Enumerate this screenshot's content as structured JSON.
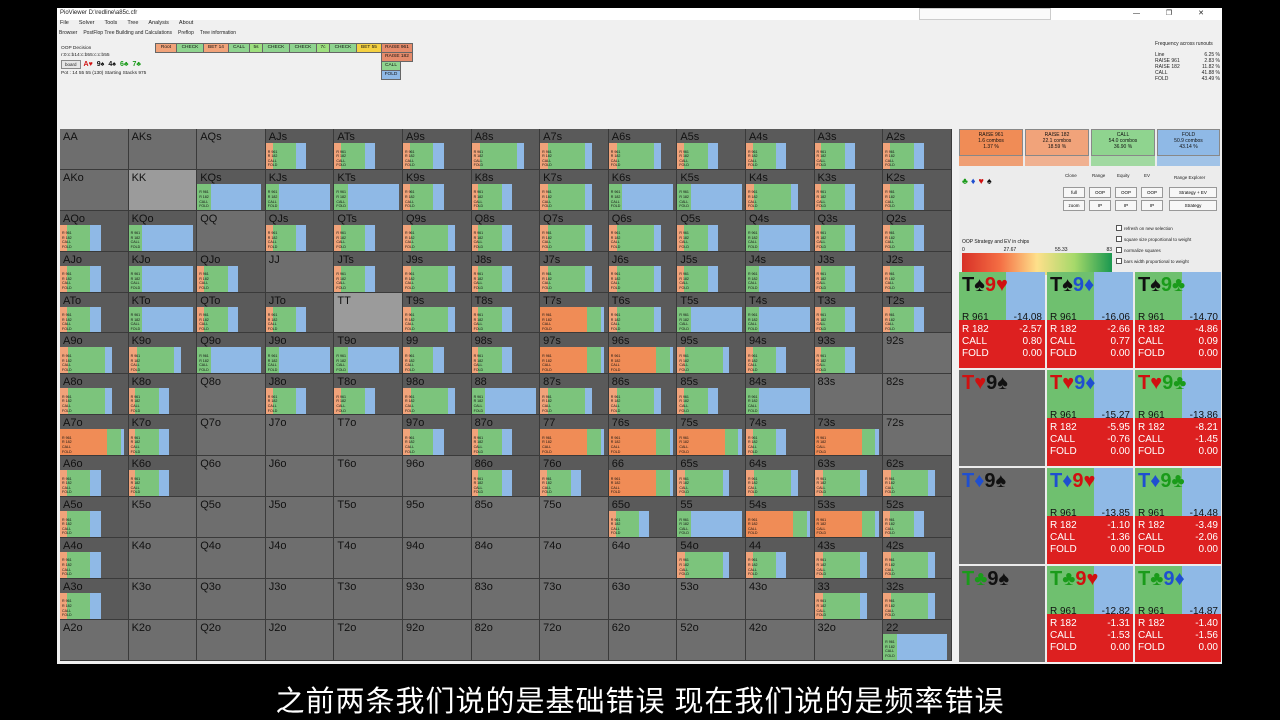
{
  "window": {
    "title": "PioViewer D:\\redline\\a85c.cfr",
    "controls": "— ❐ ✕"
  },
  "menu": [
    "File",
    "Solver",
    "Tools",
    "Tree",
    "Analysis",
    "About"
  ],
  "tabs": [
    "Browser",
    "PostFlop Tree Building and Calculations",
    "Preflop",
    "Tree information"
  ],
  "info": {
    "decision": "OOP Decision",
    "line": "r:0:c:b14:c:b55:c:c:b55",
    "board_label": "board",
    "board_cards": [
      {
        "rank": "A",
        "suit": "♥",
        "color": "#d01010"
      },
      {
        "rank": "9",
        "suit": "♠",
        "color": "#111111"
      },
      {
        "rank": "4",
        "suit": "♠",
        "color": "#111111"
      },
      {
        "rank": "6",
        "suit": "♣",
        "color": "#1a9b1a"
      },
      {
        "rank": "7",
        "suit": "♣",
        "color": "#1a9b1a"
      }
    ],
    "pot": "Pot : 14 55 55 (130) Starting Stacks 975"
  },
  "tree_nodes": [
    {
      "label": "Root",
      "color": "#f1a37a"
    },
    {
      "label": "CHECK",
      "color": "#8fd48f"
    },
    {
      "label": "BET 14",
      "color": "#f1a37a"
    },
    {
      "label": "CALL",
      "color": "#8fd48f"
    },
    {
      "label": "5s",
      "color": "#9ee07f"
    },
    {
      "label": "CHECK",
      "color": "#8fd48f"
    },
    {
      "label": "CHECK",
      "color": "#8fd48f"
    },
    {
      "label": "7c",
      "color": "#9ee07f"
    },
    {
      "label": "CHECK",
      "color": "#8fd48f"
    },
    {
      "label": "BET 55",
      "color": "#f5d142"
    },
    {
      "label": "RAISE 961",
      "color": "#e58b6b"
    },
    {
      "label": "RAISE 182",
      "color": "#e58b6b"
    },
    {
      "label": "CALL",
      "color": "#8fd48f"
    },
    {
      "label": "FOLD",
      "color": "#8fb9e6"
    }
  ],
  "freq": {
    "title": "Frequency across runouts",
    "rows": [
      {
        "name": "Line",
        "val": "6.25 %"
      },
      {
        "name": "RAISE 961",
        "val": "2.83 %"
      },
      {
        "name": "RAISE 182",
        "val": "11.82 %"
      },
      {
        "name": "CALL",
        "val": "41.88 %"
      },
      {
        "name": "FOLD",
        "val": "43.49 %"
      }
    ]
  },
  "legend": {
    "colors": {
      "raise_big": "#f08c56",
      "raise_small": "#f1a37a",
      "call": "#7cc47c",
      "fold": "#8fb9e6",
      "empty": "#6e6e6e"
    },
    "row_labels": [
      "R 961",
      "R 182",
      "CALL",
      "FOLD"
    ]
  },
  "matrix": [
    [
      {
        "l": "AA",
        "t": "e"
      },
      {
        "l": "AKs",
        "t": "e"
      },
      {
        "l": "AQs",
        "t": "e"
      },
      {
        "l": "AJs",
        "t": "m"
      },
      {
        "l": "ATs",
        "t": "m"
      },
      {
        "l": "A9s",
        "t": "m"
      },
      {
        "l": "A8s",
        "t": "c"
      },
      {
        "l": "A7s",
        "t": "c"
      },
      {
        "l": "A6s",
        "t": "c"
      },
      {
        "l": "A5s",
        "t": "m"
      },
      {
        "l": "A4s",
        "t": "m"
      },
      {
        "l": "A3s",
        "t": "m"
      },
      {
        "l": "A2s",
        "t": "m"
      }
    ],
    [
      {
        "l": "AKo",
        "t": "e"
      },
      {
        "l": "KK",
        "t": "s"
      },
      {
        "l": "KQs",
        "t": "f"
      },
      {
        "l": "KJs",
        "t": "f"
      },
      {
        "l": "KTs",
        "t": "f"
      },
      {
        "l": "K9s",
        "t": "m"
      },
      {
        "l": "K8s",
        "t": "m"
      },
      {
        "l": "K7s",
        "t": "c"
      },
      {
        "l": "K6s",
        "t": "f"
      },
      {
        "l": "K5s",
        "t": "f"
      },
      {
        "l": "K4s",
        "t": "c"
      },
      {
        "l": "K3s",
        "t": "m"
      },
      {
        "l": "K2s",
        "t": "m"
      }
    ],
    [
      {
        "l": "AQo",
        "t": "m"
      },
      {
        "l": "KQo",
        "t": "f"
      },
      {
        "l": "QQ",
        "t": "e"
      },
      {
        "l": "QJs",
        "t": "m"
      },
      {
        "l": "QTs",
        "t": "m"
      },
      {
        "l": "Q9s",
        "t": "c"
      },
      {
        "l": "Q8s",
        "t": "m"
      },
      {
        "l": "Q7s",
        "t": "c"
      },
      {
        "l": "Q6s",
        "t": "c"
      },
      {
        "l": "Q5s",
        "t": "m"
      },
      {
        "l": "Q4s",
        "t": "f"
      },
      {
        "l": "Q3s",
        "t": "m"
      },
      {
        "l": "Q2s",
        "t": "m"
      }
    ],
    [
      {
        "l": "AJo",
        "t": "m"
      },
      {
        "l": "KJo",
        "t": "f"
      },
      {
        "l": "QJo",
        "t": "m"
      },
      {
        "l": "JJ",
        "t": "e"
      },
      {
        "l": "JTs",
        "t": "m"
      },
      {
        "l": "J9s",
        "t": "c"
      },
      {
        "l": "J8s",
        "t": "m"
      },
      {
        "l": "J7s",
        "t": "c"
      },
      {
        "l": "J6s",
        "t": "c"
      },
      {
        "l": "J5s",
        "t": "m"
      },
      {
        "l": "J4s",
        "t": "f"
      },
      {
        "l": "J3s",
        "t": "m"
      },
      {
        "l": "J2s",
        "t": "m"
      }
    ],
    [
      {
        "l": "ATo",
        "t": "m"
      },
      {
        "l": "KTo",
        "t": "f"
      },
      {
        "l": "QTo",
        "t": "m"
      },
      {
        "l": "JTo",
        "t": "m"
      },
      {
        "l": "TT",
        "t": "s"
      },
      {
        "l": "T9s",
        "t": "c"
      },
      {
        "l": "T8s",
        "t": "m"
      },
      {
        "l": "T7s",
        "t": "r"
      },
      {
        "l": "T6s",
        "t": "c"
      },
      {
        "l": "T5s",
        "t": "f"
      },
      {
        "l": "T4s",
        "t": "f"
      },
      {
        "l": "T3s",
        "t": "m"
      },
      {
        "l": "T2s",
        "t": "m"
      }
    ],
    [
      {
        "l": "A9o",
        "t": "c"
      },
      {
        "l": "K9o",
        "t": "c"
      },
      {
        "l": "Q9o",
        "t": "f"
      },
      {
        "l": "J9o",
        "t": "f"
      },
      {
        "l": "T9o",
        "t": "f"
      },
      {
        "l": "99",
        "t": "m"
      },
      {
        "l": "98s",
        "t": "m"
      },
      {
        "l": "97s",
        "t": "r"
      },
      {
        "l": "96s",
        "t": "r"
      },
      {
        "l": "95s",
        "t": "c"
      },
      {
        "l": "94s",
        "t": "m"
      },
      {
        "l": "93s",
        "t": "m"
      },
      {
        "l": "92s",
        "t": "e"
      }
    ],
    [
      {
        "l": "A8o",
        "t": "c"
      },
      {
        "l": "K8o",
        "t": "m"
      },
      {
        "l": "Q8o",
        "t": "e"
      },
      {
        "l": "J8o",
        "t": "m"
      },
      {
        "l": "T8o",
        "t": "m"
      },
      {
        "l": "98o",
        "t": "c"
      },
      {
        "l": "88",
        "t": "f"
      },
      {
        "l": "87s",
        "t": "c"
      },
      {
        "l": "86s",
        "t": "c"
      },
      {
        "l": "85s",
        "t": "m"
      },
      {
        "l": "84s",
        "t": "f"
      },
      {
        "l": "83s",
        "t": "e"
      },
      {
        "l": "82s",
        "t": "e"
      }
    ],
    [
      {
        "l": "A7o",
        "t": "r"
      },
      {
        "l": "K7o",
        "t": "m"
      },
      {
        "l": "Q7o",
        "t": "e"
      },
      {
        "l": "J7o",
        "t": "e"
      },
      {
        "l": "T7o",
        "t": "e"
      },
      {
        "l": "97o",
        "t": "m"
      },
      {
        "l": "87o",
        "t": "m"
      },
      {
        "l": "77",
        "t": "r"
      },
      {
        "l": "76s",
        "t": "r"
      },
      {
        "l": "75s",
        "t": "r"
      },
      {
        "l": "74s",
        "t": "m"
      },
      {
        "l": "73s",
        "t": "r"
      },
      {
        "l": "72s",
        "t": "e"
      }
    ],
    [
      {
        "l": "A6o",
        "t": "m"
      },
      {
        "l": "K6o",
        "t": "m"
      },
      {
        "l": "Q6o",
        "t": "e"
      },
      {
        "l": "J6o",
        "t": "e"
      },
      {
        "l": "T6o",
        "t": "e"
      },
      {
        "l": "96o",
        "t": "e"
      },
      {
        "l": "86o",
        "t": "m"
      },
      {
        "l": "76o",
        "t": "m"
      },
      {
        "l": "66",
        "t": "r"
      },
      {
        "l": "65s",
        "t": "c"
      },
      {
        "l": "64s",
        "t": "c"
      },
      {
        "l": "63s",
        "t": "c"
      },
      {
        "l": "62s",
        "t": "c"
      }
    ],
    [
      {
        "l": "A5o",
        "t": "m"
      },
      {
        "l": "K5o",
        "t": "e"
      },
      {
        "l": "Q5o",
        "t": "e"
      },
      {
        "l": "J5o",
        "t": "e"
      },
      {
        "l": "T5o",
        "t": "e"
      },
      {
        "l": "95o",
        "t": "e"
      },
      {
        "l": "85o",
        "t": "e"
      },
      {
        "l": "75o",
        "t": "e"
      },
      {
        "l": "65o",
        "t": "m"
      },
      {
        "l": "55",
        "t": "f"
      },
      {
        "l": "54s",
        "t": "r"
      },
      {
        "l": "53s",
        "t": "r"
      },
      {
        "l": "52s",
        "t": "m"
      }
    ],
    [
      {
        "l": "A4o",
        "t": "m"
      },
      {
        "l": "K4o",
        "t": "e"
      },
      {
        "l": "Q4o",
        "t": "e"
      },
      {
        "l": "J4o",
        "t": "e"
      },
      {
        "l": "T4o",
        "t": "e"
      },
      {
        "l": "94o",
        "t": "e"
      },
      {
        "l": "84o",
        "t": "e"
      },
      {
        "l": "74o",
        "t": "e"
      },
      {
        "l": "64o",
        "t": "e"
      },
      {
        "l": "54o",
        "t": "c"
      },
      {
        "l": "44",
        "t": "m"
      },
      {
        "l": "43s",
        "t": "c"
      },
      {
        "l": "42s",
        "t": "c"
      }
    ],
    [
      {
        "l": "A3o",
        "t": "m"
      },
      {
        "l": "K3o",
        "t": "e"
      },
      {
        "l": "Q3o",
        "t": "e"
      },
      {
        "l": "J3o",
        "t": "e"
      },
      {
        "l": "T3o",
        "t": "e"
      },
      {
        "l": "93o",
        "t": "e"
      },
      {
        "l": "83o",
        "t": "e"
      },
      {
        "l": "73o",
        "t": "e"
      },
      {
        "l": "63o",
        "t": "e"
      },
      {
        "l": "53o",
        "t": "e"
      },
      {
        "l": "43o",
        "t": "e"
      },
      {
        "l": "33",
        "t": "c"
      },
      {
        "l": "32s",
        "t": "c"
      }
    ],
    [
      {
        "l": "A2o",
        "t": "e"
      },
      {
        "l": "K2o",
        "t": "e"
      },
      {
        "l": "Q2o",
        "t": "e"
      },
      {
        "l": "J2o",
        "t": "e"
      },
      {
        "l": "T2o",
        "t": "e"
      },
      {
        "l": "92o",
        "t": "e"
      },
      {
        "l": "82o",
        "t": "e"
      },
      {
        "l": "72o",
        "t": "e"
      },
      {
        "l": "62o",
        "t": "e"
      },
      {
        "l": "52o",
        "t": "e"
      },
      {
        "l": "42o",
        "t": "e"
      },
      {
        "l": "32o",
        "t": "e"
      },
      {
        "l": "22",
        "t": "f"
      }
    ]
  ],
  "aggregate": [
    {
      "name": "RAISE 961",
      "combos": "1.6 combos",
      "pct": "1.37 %",
      "color": "#f08c56"
    },
    {
      "name": "RAISE 182",
      "combos": "22.1 combos",
      "pct": "18.59 %",
      "color": "#f1a37a"
    },
    {
      "name": "CALL",
      "combos": "54.0 combos",
      "pct": "36.90 %",
      "color": "#8fd48f"
    },
    {
      "name": "FOLD",
      "combos": "50.9 combos",
      "pct": "43.14 %",
      "color": "#8fb9e6"
    }
  ],
  "side_controls": {
    "suits": [
      {
        "s": "♣",
        "c": "#1a9b1a"
      },
      {
        "s": "♦",
        "c": "#1f4fd0"
      },
      {
        "s": "♥",
        "c": "#d01010"
      },
      {
        "s": "♠",
        "c": "#111111"
      }
    ],
    "labels": [
      "Clone",
      "Range",
      "Equity",
      "EV"
    ],
    "buttons": [
      "full",
      "OOP",
      "OOP",
      "OOP",
      "zoom",
      "IP",
      "IP",
      "IP"
    ],
    "range_explorer": "Range Explorer",
    "strategy_ev": "Strategy + EV",
    "strategy": "Strategy",
    "ev_title": "OOP Strategy and EV in chips",
    "ev_ticks": [
      "0",
      "27.67",
      "55.33",
      "83"
    ],
    "checkboxes": [
      "refresh on new selection",
      "square size proportional to weight",
      "normalize squares",
      "bars width proportional to weight"
    ]
  },
  "combos": [
    {
      "card": [
        {
          "r": "T",
          "s": "♠",
          "c": "#111"
        },
        {
          "r": "9",
          "s": "♥",
          "c": "#d01010"
        }
      ],
      "r961": "-14.08",
      "r182": "-2.57",
      "call": "0.80",
      "fold": "0.00"
    },
    {
      "card": [
        {
          "r": "T",
          "s": "♠",
          "c": "#111"
        },
        {
          "r": "9",
          "s": "♦",
          "c": "#1f4fd0"
        }
      ],
      "r961": "-16.06",
      "r182": "-2.66",
      "call": "0.77",
      "fold": "0.00"
    },
    {
      "card": [
        {
          "r": "T",
          "s": "♠",
          "c": "#111"
        },
        {
          "r": "9",
          "s": "♣",
          "c": "#1a9b1a"
        }
      ],
      "r961": "-14.70",
      "r182": "-4.86",
      "call": "0.09",
      "fold": "0.00"
    },
    {
      "card": [
        {
          "r": "T",
          "s": "♥",
          "c": "#d01010"
        },
        {
          "r": "9",
          "s": "♠",
          "c": "#111"
        }
      ],
      "blank": true
    },
    {
      "card": [
        {
          "r": "T",
          "s": "♥",
          "c": "#d01010"
        },
        {
          "r": "9",
          "s": "♦",
          "c": "#1f4fd0"
        }
      ],
      "r961": "-15.27",
      "r182": "-5.95",
      "call": "-0.76",
      "fold": "0.00"
    },
    {
      "card": [
        {
          "r": "T",
          "s": "♥",
          "c": "#d01010"
        },
        {
          "r": "9",
          "s": "♣",
          "c": "#1a9b1a"
        }
      ],
      "r961": "-13.86",
      "r182": "-8.21",
      "call": "-1.45",
      "fold": "0.00"
    },
    {
      "card": [
        {
          "r": "T",
          "s": "♦",
          "c": "#1f4fd0"
        },
        {
          "r": "9",
          "s": "♠",
          "c": "#111"
        }
      ],
      "blank": true
    },
    {
      "card": [
        {
          "r": "T",
          "s": "♦",
          "c": "#1f4fd0"
        },
        {
          "r": "9",
          "s": "♥",
          "c": "#d01010"
        }
      ],
      "r961": "-13.85",
      "r182": "-1.10",
      "call": "-1.36",
      "fold": "0.00"
    },
    {
      "card": [
        {
          "r": "T",
          "s": "♦",
          "c": "#1f4fd0"
        },
        {
          "r": "9",
          "s": "♣",
          "c": "#1a9b1a"
        }
      ],
      "r961": "-14.48",
      "r182": "-3.49",
      "call": "-2.06",
      "fold": "0.00"
    },
    {
      "card": [
        {
          "r": "T",
          "s": "♣",
          "c": "#1a9b1a"
        },
        {
          "r": "9",
          "s": "♠",
          "c": "#111"
        }
      ],
      "blank": true
    },
    {
      "card": [
        {
          "r": "T",
          "s": "♣",
          "c": "#1a9b1a"
        },
        {
          "r": "9",
          "s": "♥",
          "c": "#d01010"
        }
      ],
      "r961": "-12.82",
      "r182": "-1.31",
      "call": "-1.53",
      "fold": "0.00"
    },
    {
      "card": [
        {
          "r": "T",
          "s": "♣",
          "c": "#1a9b1a"
        },
        {
          "r": "9",
          "s": "♦",
          "c": "#1f4fd0"
        }
      ],
      "r961": "-14.87",
      "r182": "-1.40",
      "call": "-1.56",
      "fold": "0.00"
    }
  ],
  "subtitle": "之前两条我们说的是基础错误 现在我们说的是频率错误"
}
